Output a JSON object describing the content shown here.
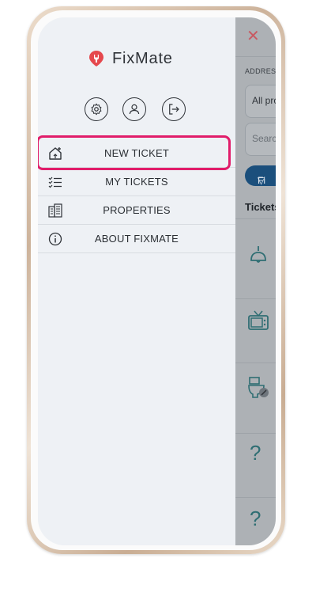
{
  "app": {
    "name": "FixMate",
    "logo_color": "#e5484d"
  },
  "drawer": {
    "header_icons": [
      "gear-icon",
      "user-icon",
      "logout-icon"
    ],
    "menu": [
      {
        "label": "NEW TICKET",
        "icon": "home-plus-icon",
        "highlighted": true
      },
      {
        "label": "MY TICKETS",
        "icon": "checklist-icon"
      },
      {
        "label": "PROPERTIES",
        "icon": "building-icon"
      },
      {
        "label": "ABOUT FIXMATE",
        "icon": "info-icon"
      }
    ],
    "highlight_color": "#e11d6a"
  },
  "background_app": {
    "address_label": "ADDRESS",
    "address_value": "All pro",
    "search_placeholder": "Search",
    "filter_label": "Fi",
    "tickets_heading": "Tickets",
    "ticket_icons": [
      "lamp-icon",
      "tv-icon",
      "toilet-icon",
      "question-icon",
      "question-icon"
    ]
  }
}
